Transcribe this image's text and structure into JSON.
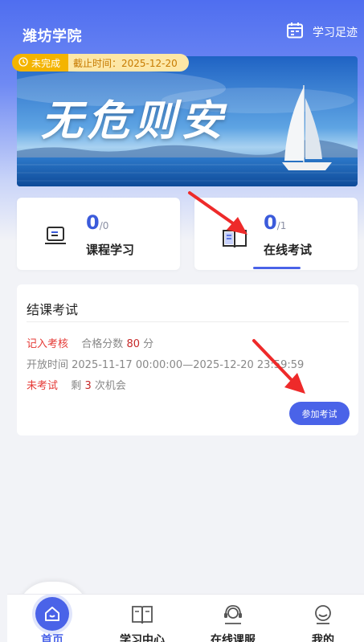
{
  "header": {
    "title": "潍坊学院",
    "footprint_label": "学习足迹"
  },
  "banner": {
    "status_label": "未完成",
    "deadline": "截止时间：2025-12-20",
    "slogan": "无危则安"
  },
  "stats": [
    {
      "value": "0",
      "total": "/0",
      "label": "课程学习"
    },
    {
      "value": "0",
      "total": "/1",
      "label": "在线考试"
    }
  ],
  "exam": {
    "title": "结课考试",
    "assess_label": "记入考核",
    "pass_prefix": "合格分数",
    "pass_score": "80",
    "pass_unit": "分",
    "open_time": "开放时间 2025-11-17 00:00:00—2025-12-20 23:59:59",
    "status": "未考试",
    "chances_prefix": "剩",
    "chances": "3",
    "chances_suffix": "次机会",
    "join_button": "参加考试"
  },
  "tabs": [
    {
      "label": "首页"
    },
    {
      "label": "学习中心"
    },
    {
      "label": "在线课服"
    },
    {
      "label": "我的"
    }
  ],
  "colors": {
    "primary": "#4a63e8",
    "warning": "#f4b400",
    "danger": "#e53935"
  },
  "icons": {
    "footprint": "calendar-icon",
    "course": "monitor-icon",
    "exam": "book-icon",
    "home": "home-icon",
    "study": "book-open-icon",
    "service": "headset-icon",
    "me": "user-icon"
  }
}
